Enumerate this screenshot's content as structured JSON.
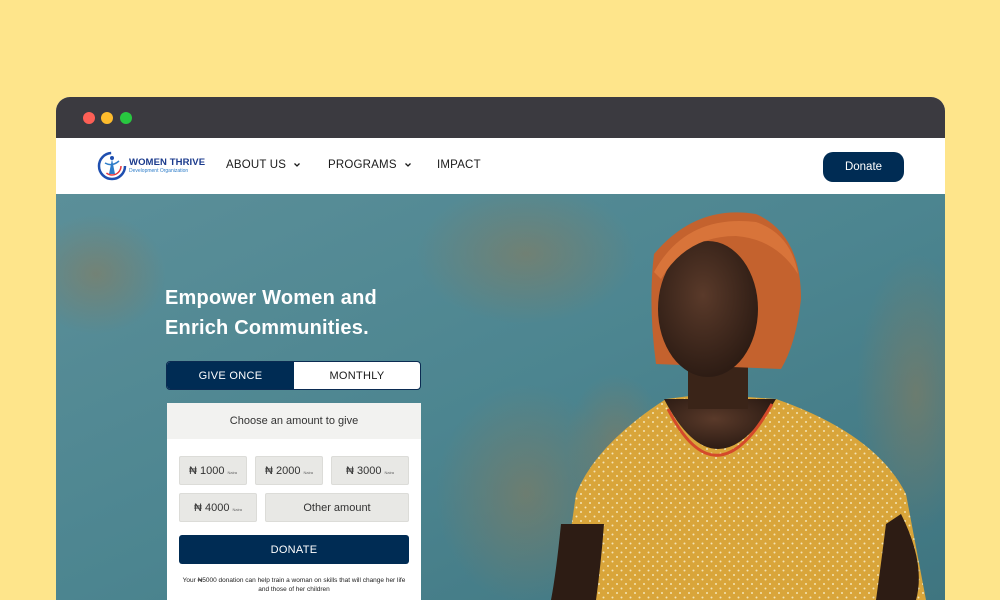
{
  "window": {
    "controls": [
      "close",
      "minimize",
      "maximize"
    ]
  },
  "nav": {
    "logo": {
      "title": "WOMEN THRIVE",
      "subtitle": "Development Organization"
    },
    "items": [
      {
        "label": "ABOUT US",
        "dropdown": true
      },
      {
        "label": "PROGRAMS",
        "dropdown": true
      },
      {
        "label": "IMPACT",
        "dropdown": false
      }
    ],
    "donate_label": "Donate"
  },
  "hero": {
    "headline_line1": "Empower Women and",
    "headline_line2": "Enrich Communities."
  },
  "donation": {
    "tabs": {
      "once": "GIVE ONCE",
      "monthly": "MONTHLY",
      "active": "once"
    },
    "prompt": "Choose an amount to give",
    "amounts": [
      {
        "label": "₦ 1000",
        "unit": "Naira"
      },
      {
        "label": "₦ 2000",
        "unit": "Naira"
      },
      {
        "label": "₦ 3000",
        "unit": "Naira"
      },
      {
        "label": "₦ 4000",
        "unit": "Naira"
      }
    ],
    "other_label": "Other amount",
    "submit_label": "DONATE",
    "impact_note": "Your ₦5000 donation can help train a woman on skills that will change her life and those of her children"
  },
  "colors": {
    "page_bg": "#fee58b",
    "brand_navy": "#002c54",
    "titlebar": "#3b3a40",
    "hero_teal": "#4f8d96"
  }
}
